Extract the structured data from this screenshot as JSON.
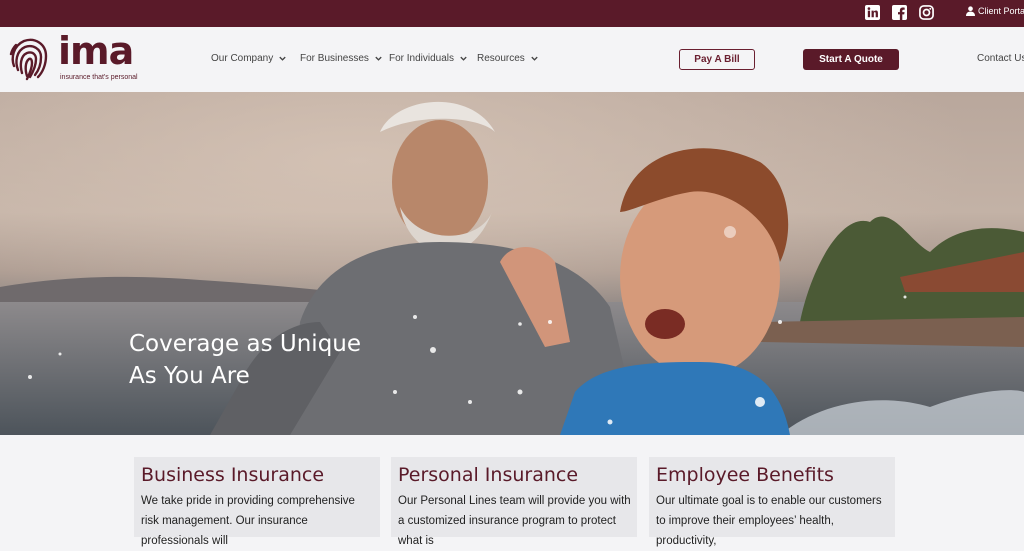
{
  "topbar": {
    "social_icons": [
      "linkedin-icon",
      "facebook-icon",
      "instagram-icon"
    ],
    "client_portal_label": "Client Portal"
  },
  "logo": {
    "wordmark": "ima",
    "tagline": "insurance that's personal"
  },
  "nav": {
    "items": [
      {
        "label": "Our Company"
      },
      {
        "label": "For Businesses"
      },
      {
        "label": "For Individuals"
      },
      {
        "label": "Resources"
      }
    ],
    "pay_bill_label": "Pay A Bill",
    "start_quote_label": "Start A Quote",
    "contact_label": "Contact Us"
  },
  "hero": {
    "title_line1": "Coverage as Unique",
    "title_line2": "As You Are"
  },
  "cards": [
    {
      "title": "Business Insurance",
      "text": "We take pride in providing comprehensive risk management.  Our insurance professionals will"
    },
    {
      "title": "Personal Insurance",
      "text": "Our Personal Lines team will provide you with a customized insurance program to protect what is"
    },
    {
      "title": "Employee Benefits",
      "text": "Our ultimate goal is to enable our customers to improve their employees’ health, productivity,"
    }
  ],
  "colors": {
    "brand": "#5a1a29",
    "background": "#f4f4f6",
    "card": "#e7e7ea"
  }
}
